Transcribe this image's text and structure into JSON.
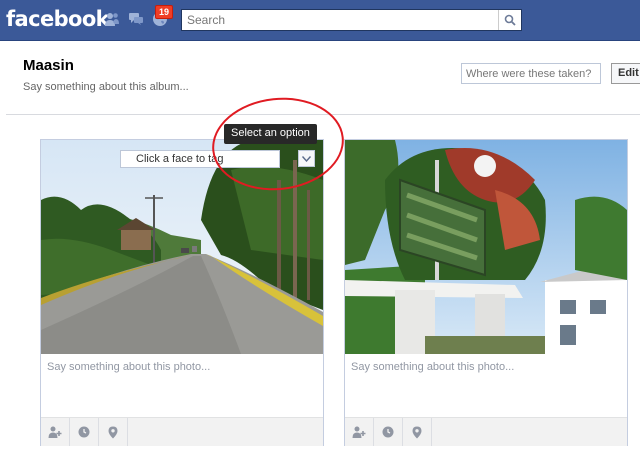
{
  "header": {
    "logo": "facebook",
    "notification_count": "19",
    "search_placeholder": "Search"
  },
  "album": {
    "title": "Maasin",
    "description_placeholder": "Say something about this album...",
    "location_placeholder": "Where were these taken?",
    "edit_label": "Edit"
  },
  "photos": [
    {
      "caption_placeholder": "Say something about this photo..."
    },
    {
      "caption_placeholder": "Say something about this photo..."
    }
  ],
  "tagging": {
    "tag_prompt": "Click a face to tag",
    "tooltip": "Select an option"
  },
  "colors": {
    "brand": "#3b5998",
    "badge": "#f03d25",
    "annotation": "#e01b22"
  }
}
